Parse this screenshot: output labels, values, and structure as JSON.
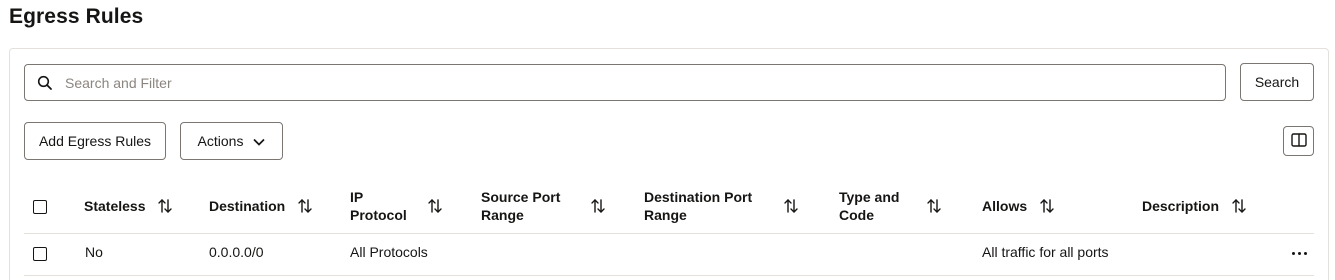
{
  "page": {
    "title": "Egress Rules"
  },
  "toolbar": {
    "search_placeholder": "Search and Filter",
    "search_button": "Search",
    "add_button": "Add Egress Rules",
    "actions_button": "Actions"
  },
  "table": {
    "columns": [
      {
        "label": "Stateless"
      },
      {
        "label": "Destination"
      },
      {
        "label_line1": "IP",
        "label_line2": "Protocol"
      },
      {
        "label_line1": "Source Port",
        "label_line2": "Range"
      },
      {
        "label_line1": "Destination Port",
        "label_line2": "Range"
      },
      {
        "label_line1": "Type and",
        "label_line2": "Code"
      },
      {
        "label": "Allows"
      },
      {
        "label": "Description"
      }
    ],
    "rows": [
      {
        "stateless": "No",
        "destination": "0.0.0.0/0",
        "ip_protocol": "All Protocols",
        "source_port_range": "",
        "destination_port_range": "",
        "type_and_code": "",
        "allows": "All traffic for all ports",
        "description": ""
      }
    ]
  },
  "icons": {
    "search": "search-icon",
    "chevron": "chevron-down-icon",
    "sort": "sort-icon",
    "columns": "columns-icon",
    "more": "more-actions-icon"
  }
}
